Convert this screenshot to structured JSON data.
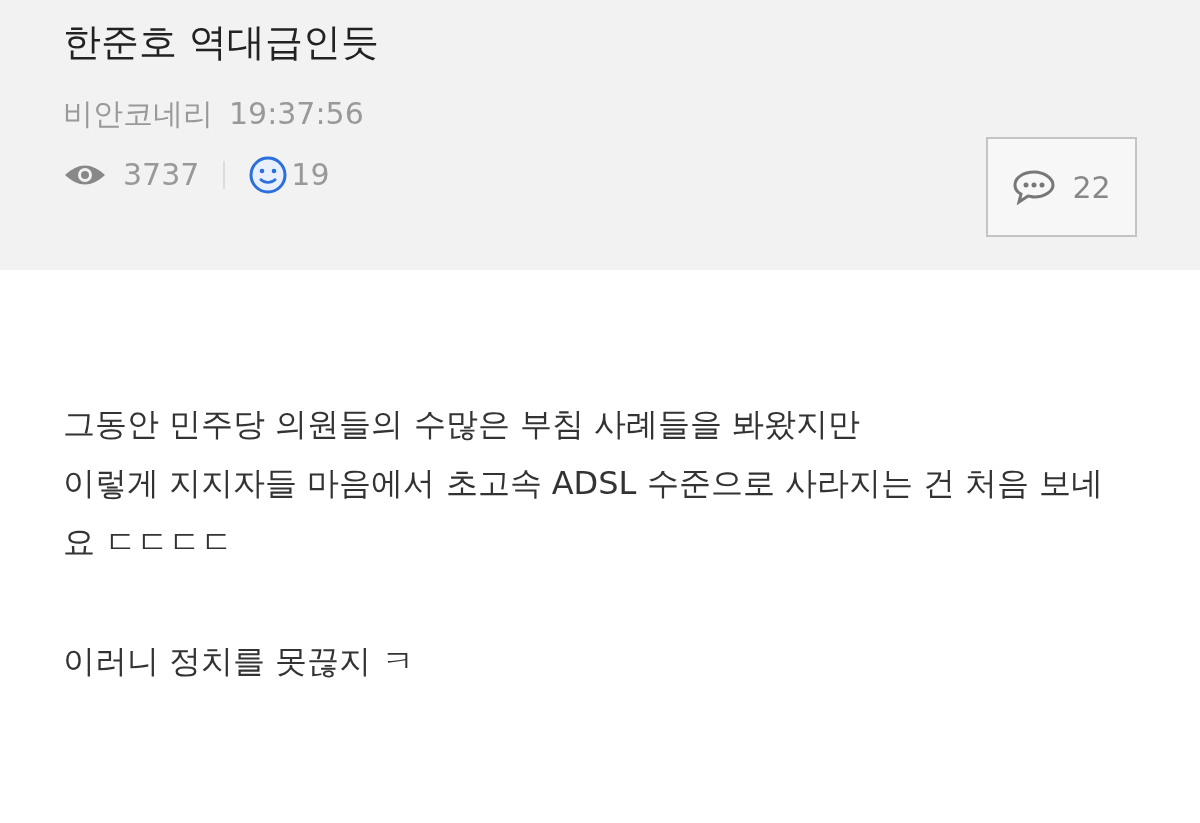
{
  "post": {
    "title": "한준호 역대급인듯",
    "author": "비안코네리",
    "time": "19:37:56",
    "views": "3737",
    "likes": "19",
    "comments": "22"
  },
  "body": {
    "paragraphs": [
      [
        "그동안 민주당 의원들의 수많은 부침 사례들을 봐왔지만",
        "이렇게 지지자들 마음에서 초고속 ADSL 수준으로 사라지는 건 처음 보네",
        "요 ㄷㄷㄷㄷ"
      ],
      [
        "이러니 정치를 못끊지 ㅋ"
      ]
    ]
  }
}
